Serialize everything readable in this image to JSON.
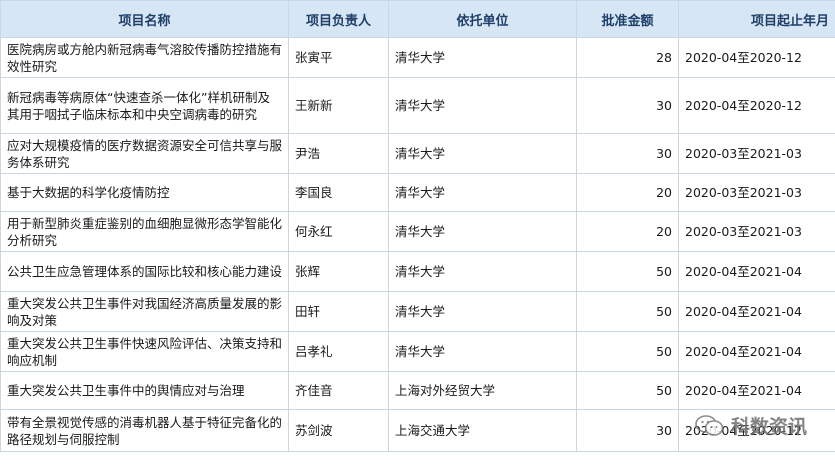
{
  "table": {
    "headers": [
      "项目名称",
      "项目负责人",
      "依托单位",
      "批准金额",
      "项目起止年月"
    ],
    "rows": [
      {
        "name": "医院病房或方舱内新冠病毒气溶胶传播防控措施有效性研究",
        "leader": "张寅平",
        "org": "清华大学",
        "amount": "28",
        "period": "2020-04至2020-12"
      },
      {
        "name": "新冠病毒等病原体“快速查杀一体化”样机研制及其用于咽拭子临床标本和中央空调病毒的研究",
        "leader": "王新新",
        "org": "清华大学",
        "amount": "30",
        "period": "2020-04至2020-12"
      },
      {
        "name": "应对大规模疫情的医疗数据资源安全可信共享与服务体系研究",
        "leader": "尹浩",
        "org": "清华大学",
        "amount": "30",
        "period": "2020-03至2021-03"
      },
      {
        "name": "基于大数据的科学化疫情防控",
        "leader": "李国良",
        "org": "清华大学",
        "amount": "20",
        "period": "2020-03至2021-03"
      },
      {
        "name": "用于新型肺炎重症鉴别的血细胞显微形态学智能化分析研究",
        "leader": "何永红",
        "org": "清华大学",
        "amount": "20",
        "period": "2020-03至2021-03"
      },
      {
        "name": "公共卫生应急管理体系的国际比较和核心能力建设",
        "leader": "张辉",
        "org": "清华大学",
        "amount": "50",
        "period": "2020-04至2021-04"
      },
      {
        "name": "重大突发公共卫生事件对我国经济高质量发展的影响及对策",
        "leader": "田轩",
        "org": "清华大学",
        "amount": "50",
        "period": "2020-04至2021-04"
      },
      {
        "name": "重大突发公共卫生事件快速风险评估、决策支持和响应机制",
        "leader": "吕孝礼",
        "org": "清华大学",
        "amount": "50",
        "period": "2020-04至2021-04"
      },
      {
        "name": "重大突发公共卫生事件中的舆情应对与治理",
        "leader": "齐佳音",
        "org": "上海对外经贸大学",
        "amount": "50",
        "period": "2020-04至2021-04"
      },
      {
        "name": "带有全景视觉传感的消毒机器人基于特征完备化的路径规划与伺服控制",
        "leader": "苏剑波",
        "org": "上海交通大学",
        "amount": "30",
        "period": "2020-04至2020-12"
      }
    ]
  },
  "watermark": {
    "text": "科数资讯",
    "icon": "wechat-icon"
  },
  "colors": {
    "header_bg": "#d6e6f4",
    "header_text": "#1f3f6a",
    "border": "#c9d6e3"
  }
}
